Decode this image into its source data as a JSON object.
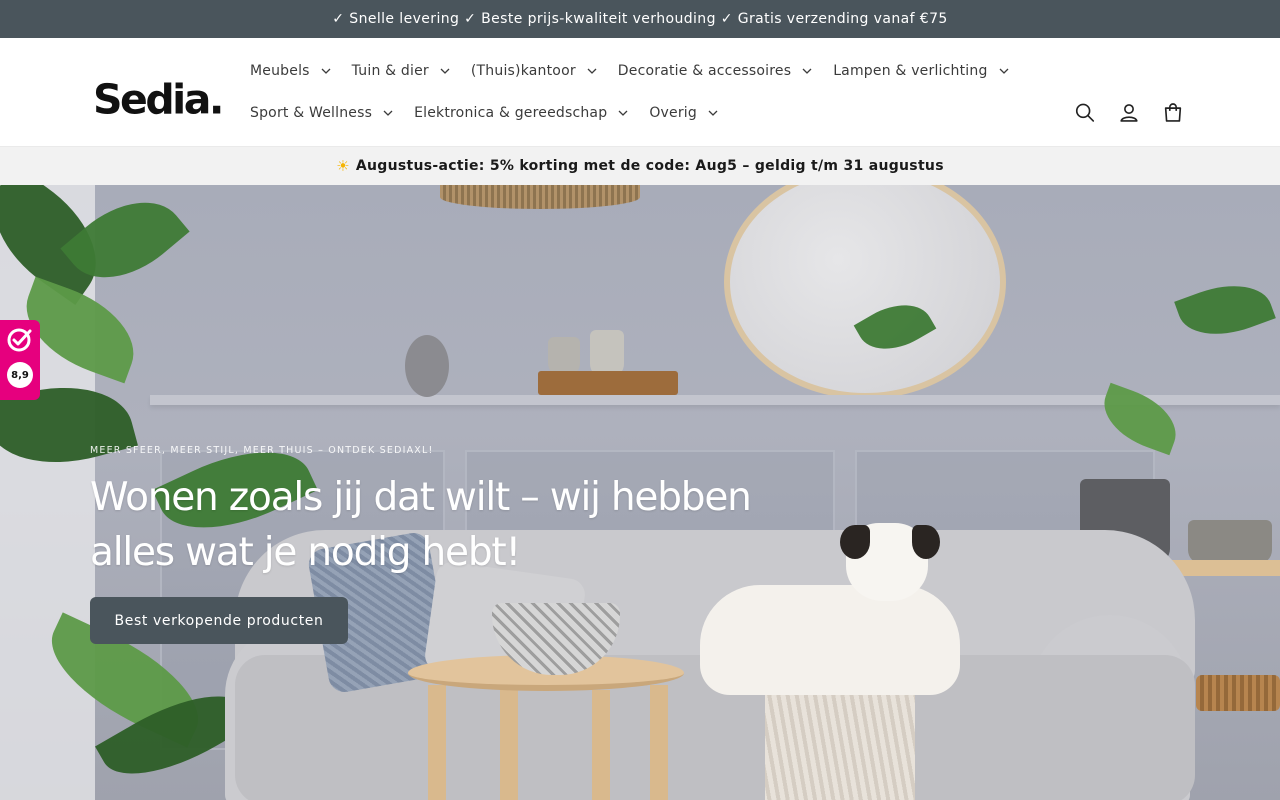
{
  "topbar": {
    "announcement": "✓ Snelle levering ✓ Beste prijs-kwaliteit verhouding ✓ Gratis verzending vanaf €75"
  },
  "header": {
    "logo": "Sedia.",
    "nav": {
      "row1": [
        {
          "label": "Meubels",
          "icon": "chevron-down-icon"
        },
        {
          "label": "Tuin & dier",
          "icon": "chevron-down-icon"
        },
        {
          "label": "(Thuis)kantoor",
          "icon": "chevron-down-icon"
        },
        {
          "label": "Decoratie & accessoires",
          "icon": "chevron-down-icon"
        },
        {
          "label": "Lampen & verlichting",
          "icon": "chevron-down-icon"
        }
      ],
      "row2": [
        {
          "label": "Sport & Wellness",
          "icon": "chevron-down-icon"
        },
        {
          "label": "Elektronica & gereedschap",
          "icon": "chevron-down-icon"
        },
        {
          "label": "Overig",
          "icon": "chevron-down-icon"
        }
      ]
    },
    "icons": [
      "search-icon",
      "account-icon",
      "cart-icon"
    ]
  },
  "promo": {
    "icon": "sun-icon",
    "text": "Augustus-actie: 5% korting met de code: Aug5 – geldig t/m 31 augustus"
  },
  "hero": {
    "kicker": "MEER SFEER, MEER STIJL, MEER THUIS – ONTDEK SEDIAXL!",
    "headline_line1": "Wonen zoals jij dat wilt – wij hebben",
    "headline_line2": "alles wat je nodig hebt!",
    "cta_label": "Best verkopende producten"
  },
  "review_badge": {
    "icon": "kiyoh-check-icon",
    "rating": "8,9"
  },
  "colors": {
    "topbar_bg": "#4a555c",
    "cta_bg": "#4a555c",
    "promo_bg": "#f2f2f2",
    "badge_bg": "#e6007e"
  }
}
